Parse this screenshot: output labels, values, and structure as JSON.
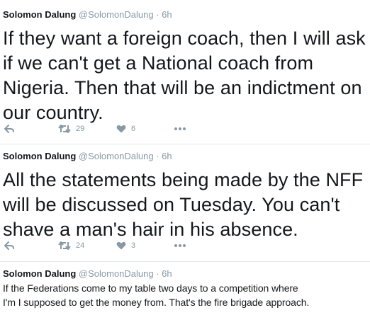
{
  "tweets": [
    {
      "name": "Solomon Dalung",
      "handle": "@SolomonDalung",
      "time": "· 6h",
      "text": "If they want a foreign coach, then I will ask if we can't get a National coach from Nigeria. Then that will be an indictment on our country.",
      "retweets": "29",
      "likes": "6"
    },
    {
      "name": "Solomon Dalung",
      "handle": "@SolomonDalung",
      "time": "· 6h",
      "text": "All the statements being made by the NFF will be discussed on Tuesday.  You can't shave a man's hair in his absence.",
      "retweets": "24",
      "likes": "3"
    },
    {
      "name": "Solomon Dalung",
      "handle": "@SolomonDalung",
      "time": "· 6h",
      "text_lines": [
        "If the Federations come to my table two days to a competition where",
        "I'm I supposed to get the money from. That's the fire brigade approach."
      ]
    }
  ],
  "icons": {
    "reply": "reply-icon",
    "retweet": "retweet-icon",
    "like": "heart-icon",
    "more": "more-icon"
  },
  "colors": {
    "text": "#14171a",
    "meta": "#8899a6",
    "divider": "#e1e8ed"
  }
}
